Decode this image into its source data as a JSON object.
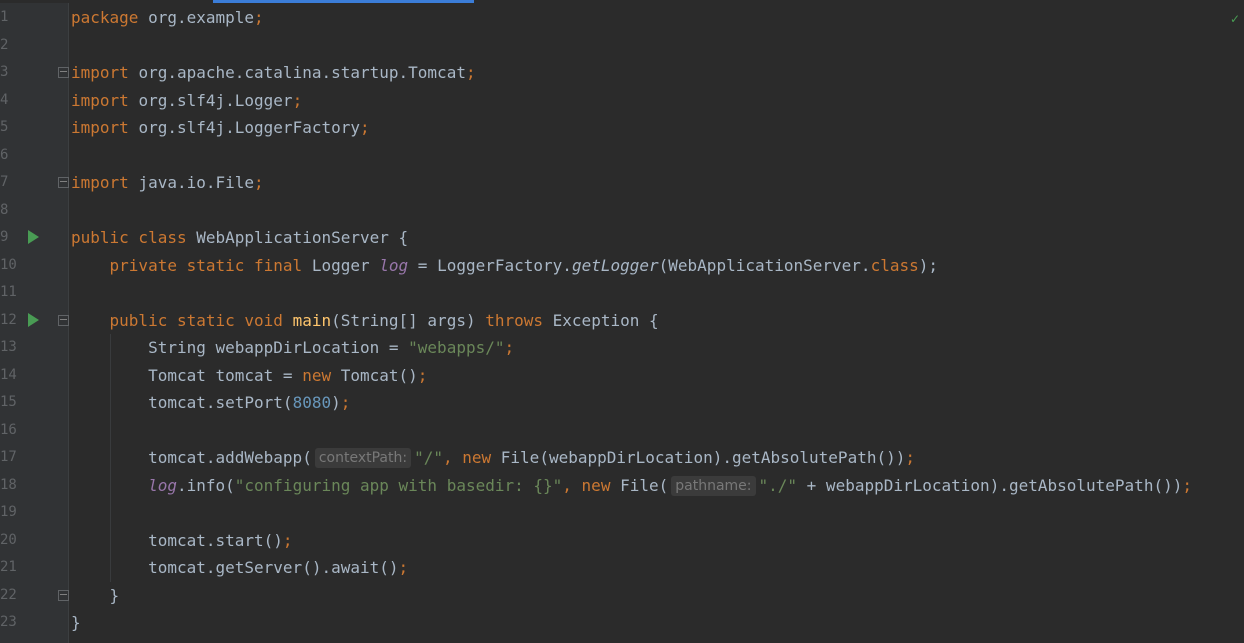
{
  "editor": {
    "lines": [
      {
        "n": "1",
        "segments": [
          {
            "t": "package ",
            "c": "kw"
          },
          {
            "t": "org.example",
            "c": ""
          },
          {
            "t": ";",
            "c": "kw"
          }
        ]
      },
      {
        "n": "2",
        "segments": []
      },
      {
        "n": "3",
        "segments": [
          {
            "t": "import ",
            "c": "kw"
          },
          {
            "t": "org.apache.catalina.startup.Tomcat",
            "c": ""
          },
          {
            "t": ";",
            "c": "kw"
          }
        ],
        "fold": true
      },
      {
        "n": "4",
        "segments": [
          {
            "t": "import ",
            "c": "kw"
          },
          {
            "t": "org.slf4j.Logger",
            "c": ""
          },
          {
            "t": ";",
            "c": "kw"
          }
        ]
      },
      {
        "n": "5",
        "segments": [
          {
            "t": "import ",
            "c": "kw"
          },
          {
            "t": "org.slf4j.LoggerFactory",
            "c": ""
          },
          {
            "t": ";",
            "c": "kw"
          }
        ]
      },
      {
        "n": "6",
        "segments": []
      },
      {
        "n": "7",
        "segments": [
          {
            "t": "import ",
            "c": "kw"
          },
          {
            "t": "java.io.File",
            "c": ""
          },
          {
            "t": ";",
            "c": "kw"
          }
        ],
        "fold": true
      },
      {
        "n": "8",
        "segments": []
      },
      {
        "n": "9",
        "segments": [
          {
            "t": "public class ",
            "c": "kw"
          },
          {
            "t": "WebApplicationServer {",
            "c": ""
          }
        ],
        "run": true
      },
      {
        "n": "10",
        "segments": [
          {
            "t": "    private static final ",
            "c": "kw"
          },
          {
            "t": "Logger ",
            "c": ""
          },
          {
            "t": "log",
            "c": "fld"
          },
          {
            "t": " = LoggerFactory.",
            "c": ""
          },
          {
            "t": "getLogger",
            "c": "it"
          },
          {
            "t": "(WebApplicationServer.",
            "c": ""
          },
          {
            "t": "class",
            "c": "kw"
          },
          {
            "t": ");",
            "c": ""
          }
        ]
      },
      {
        "n": "11",
        "segments": []
      },
      {
        "n": "12",
        "segments": [
          {
            "t": "    public static void ",
            "c": "kw"
          },
          {
            "t": "main",
            "c": "fn"
          },
          {
            "t": "(String[] args) ",
            "c": ""
          },
          {
            "t": "throws ",
            "c": "kw"
          },
          {
            "t": "Exception {",
            "c": ""
          }
        ],
        "run": true,
        "fold": true
      },
      {
        "n": "13",
        "segments": [
          {
            "t": "        String webappDirLocation = ",
            "c": ""
          },
          {
            "t": "\"webapps/\"",
            "c": "str"
          },
          {
            "t": ";",
            "c": "kw"
          }
        ]
      },
      {
        "n": "14",
        "segments": [
          {
            "t": "        Tomcat tomcat = ",
            "c": ""
          },
          {
            "t": "new ",
            "c": "kw"
          },
          {
            "t": "Tomcat()",
            "c": ""
          },
          {
            "t": ";",
            "c": "kw"
          }
        ]
      },
      {
        "n": "15",
        "segments": [
          {
            "t": "        tomcat.setPort(",
            "c": ""
          },
          {
            "t": "8080",
            "c": "num"
          },
          {
            "t": ")",
            "c": ""
          },
          {
            "t": ";",
            "c": "kw"
          }
        ]
      },
      {
        "n": "16",
        "segments": []
      },
      {
        "n": "17",
        "segments": [
          {
            "t": "        tomcat.addWebapp(",
            "c": ""
          },
          {
            "t": "contextPath:",
            "c": "hint"
          },
          {
            "t": "\"/\"",
            "c": "str"
          },
          {
            "t": ", ",
            "c": "kw"
          },
          {
            "t": "new ",
            "c": "kw"
          },
          {
            "t": "File(webappDirLocation).getAbsolutePath())",
            "c": ""
          },
          {
            "t": ";",
            "c": "kw"
          }
        ]
      },
      {
        "n": "18",
        "segments": [
          {
            "t": "        ",
            "c": ""
          },
          {
            "t": "log",
            "c": "fld"
          },
          {
            "t": ".info(",
            "c": ""
          },
          {
            "t": "\"configuring app with basedir: {}\"",
            "c": "str"
          },
          {
            "t": ", ",
            "c": "kw"
          },
          {
            "t": "new ",
            "c": "kw"
          },
          {
            "t": "File(",
            "c": ""
          },
          {
            "t": "pathname:",
            "c": "hint"
          },
          {
            "t": "\"./\"",
            "c": "str"
          },
          {
            "t": " + webappDirLocation).getAbsolutePath())",
            "c": ""
          },
          {
            "t": ";",
            "c": "kw"
          }
        ]
      },
      {
        "n": "19",
        "segments": []
      },
      {
        "n": "20",
        "segments": [
          {
            "t": "        tomcat.start()",
            "c": ""
          },
          {
            "t": ";",
            "c": "kw"
          }
        ]
      },
      {
        "n": "21",
        "segments": [
          {
            "t": "        tomcat.getServer().await()",
            "c": ""
          },
          {
            "t": ";",
            "c": "kw"
          }
        ]
      },
      {
        "n": "22",
        "segments": [
          {
            "t": "    }",
            "c": ""
          }
        ],
        "fold": true
      },
      {
        "n": "23",
        "segments": [
          {
            "t": "}",
            "c": ""
          }
        ]
      }
    ]
  },
  "icons": {
    "run": "run-gutter-icon",
    "fold": "fold-icon",
    "status": "inspection-ok-icon"
  },
  "colors": {
    "background": "#2b2b2b",
    "keyword": "#cc7832",
    "string": "#6a8759",
    "number": "#6897bb",
    "field": "#9876aa",
    "method": "#ffc66d",
    "run": "#499c54"
  }
}
